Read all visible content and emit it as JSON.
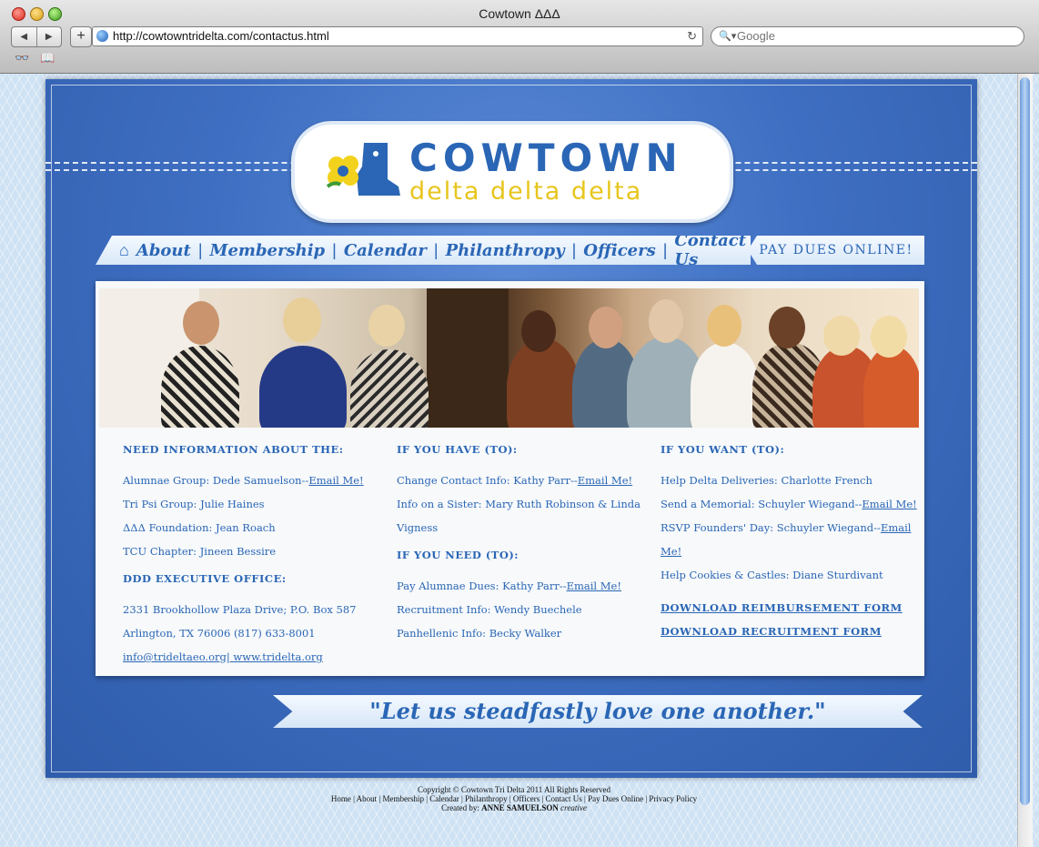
{
  "window": {
    "title": "Cowtown ΔΔΔ"
  },
  "toolbar": {
    "back": "◀",
    "forward": "▶",
    "add": "+",
    "url": "http://cowtowntridelta.com/contactus.html",
    "reload": "↻",
    "search_placeholder": "Google",
    "search_icon": "🔍▾",
    "bookmark_reader": "👓",
    "bookmark_book": "📖"
  },
  "logo": {
    "title": "COWTOWN",
    "subtitle": "delta delta delta"
  },
  "nav": {
    "items": [
      "About",
      "Membership",
      "Calendar",
      "Philanthropy",
      "Officers",
      "Contact Us"
    ],
    "sep": "|",
    "pay_dues": "PAY DUES ONLINE!"
  },
  "col1": {
    "heading1": "NEED INFORMATION ABOUT THE:",
    "alumnae_text": "Alumnae Group: Dede Samuelson--",
    "alumnae_link": "Email Me!",
    "tripsi": "Tri Psi Group: Julie Haines",
    "foundation": "ΔΔΔ Foundation: Jean Roach",
    "tcu": "TCU Chapter: Jineen Bessire",
    "heading2": "DDD EXECUTIVE OFFICE:",
    "address1": "2331 Brookhollow Plaza Drive; P.O. Box 587",
    "address2": "Arlington, TX 76006 (817) 633-8001",
    "email_link": "info@trideltaeo.org",
    "web_link": "| www.tridelta.org"
  },
  "col2": {
    "heading1": "IF YOU HAVE (TO):",
    "change_text": "Change Contact Info: Kathy Parr--",
    "change_link": "Email Me!",
    "sister_1": "Info on a Sister: Mary Ruth Robinson & Linda",
    "sister_2": "Vigness",
    "heading2": "IF YOU NEED (TO):",
    "dues_text": "Pay Alumnae Dues: Kathy Parr--",
    "dues_link": "Email Me!",
    "recruit": "Recruitment Info: Wendy Buechele",
    "panhel": "Panhellenic Info: Becky Walker"
  },
  "col3": {
    "heading1": "IF YOU WANT (TO):",
    "deliveries": "Help Delta Deliveries: Charlotte French",
    "memorial_text": "Send a Memorial: Schuyler Wiegand--",
    "memorial_link": "Email Me!",
    "rsvp_text": "RSVP Founders' Day: Schuyler Wiegand--",
    "rsvp_link": "Email Me!",
    "cookies": "Help Cookies & Castles: Diane Sturdivant",
    "dl1": "DOWNLOAD REIMBURSEMENT FORM",
    "dl2": "DOWNLOAD RECRUITMENT FORM"
  },
  "motto": "\"Let us steadfastly love one another.\"",
  "footer": {
    "copyright": "Copyright © Cowtown Tri Delta 2011 All Rights Reserved",
    "links": [
      "Home",
      "About",
      "Membership",
      "Calendar",
      "Philanthropy",
      "Officers",
      "Contact Us",
      "Pay Dues Online",
      "Privacy Policy"
    ],
    "created_prefix": "Created by: ",
    "created_name": "ANNE SAMUELSON",
    "created_suffix": " creative"
  },
  "colors": {
    "brand_blue": "#2a66b5",
    "gold": "#e8c51c",
    "background_blue": "#3f6fc2"
  }
}
